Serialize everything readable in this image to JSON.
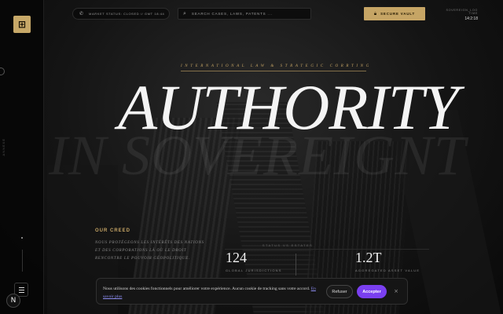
{
  "sidebar": {
    "logo_glyph": "⊞",
    "vertical_label": "ANNEXE",
    "menu_icon": "hamburger-icon",
    "badge_text": "N"
  },
  "topbar": {
    "market_icon": "phone-icon",
    "market_status": "MARKET STATUS: CLOSED // GMT 18:44",
    "search_placeholder": "SEARCH CASES, LAWS, PATENTS ...",
    "vault_label": "SECURE VAULT",
    "sovereign_key": "SOVEREIGN_LOG TIME",
    "sovereign_value": "14:2:18"
  },
  "hero": {
    "tagline": "INTERNATIONAL LAW & STRATEGIC CORRTING",
    "title": "AUTHORITY",
    "ghost": "IN SOVEREIGNT"
  },
  "creed": {
    "title": "OUR CREED",
    "text": "NOUS PROTÉGEONS LES INTÉRÊTS DES NATIONS ET DES CORPORATIONS LÀ OÙ LE DROIT RENCONTRE LE POUVOIR GÉOPOLITIQUE."
  },
  "stats": {
    "caption": "STATUS VS ESTATES",
    "items": [
      {
        "value": "124",
        "label": "GLOBAL JURISDICTIONS"
      },
      {
        "value": "1.2T",
        "label": "AGGREGATED ASSET VALUE"
      }
    ]
  },
  "cookie": {
    "message": "Nous utilisons des cookies fonctionnels pour améliorer votre expérience. Aucun cookie de tracking sans votre accord.",
    "link": "En savoir plus",
    "refuse": "Refuser",
    "accept": "Accepter",
    "close": "×"
  },
  "colors": {
    "gold": "#c6a565",
    "accept_purple": "#7a3ff0",
    "background": "#0c0c0c"
  }
}
